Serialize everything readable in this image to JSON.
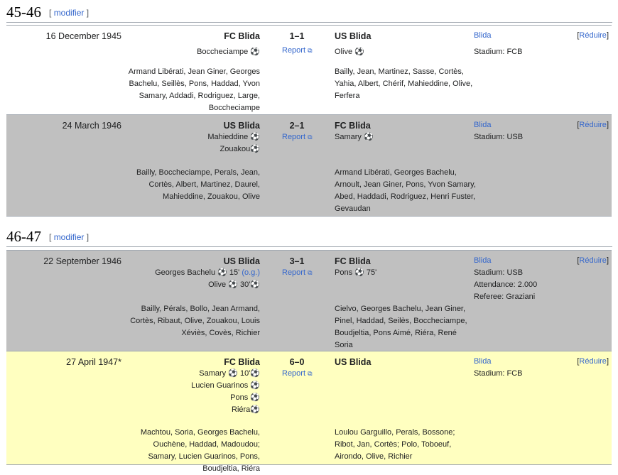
{
  "sections": [
    {
      "title": "45-46",
      "edit_open": "[",
      "edit_label": "modifier",
      "edit_close": "]"
    },
    {
      "title": "46-47",
      "edit_open": "[",
      "edit_label": "modifier",
      "edit_close": "]"
    }
  ],
  "matches": [
    {
      "date": "16 December 1945",
      "home": "FC Blida",
      "score": "1–1",
      "away": "US Blida",
      "venue": "Blida",
      "toggle_label": "Réduire",
      "report": "Report",
      "home_goals": [
        "Boccheciampe ⚽"
      ],
      "away_goals": [
        "Olive ⚽"
      ],
      "stadium_lines": [
        "Stadium: FCB"
      ],
      "home_lineup": "Armand Libérati, Jean Giner, Georges Bachelu, Seillès, Pons, Haddad, Yvon Samary, Addadi, Rodriguez, Large, Boccheciampe",
      "away_lineup": "Bailly, Jean, Martinez, Sasse, Cortès, Yahia, Albert, Chérif, Mahieddine, Olive, Ferfera"
    },
    {
      "date": "24 March 1946",
      "home": "US Blida",
      "score": "2–1",
      "away": "FC Blida",
      "venue": "Blida",
      "toggle_label": "Réduire",
      "report": "Report",
      "home_goals": [
        "Mahieddine ⚽",
        "Zouakou⚽"
      ],
      "away_goals": [
        "Samary ⚽"
      ],
      "stadium_lines": [
        "Stadium: USB"
      ],
      "home_lineup": "Bailly, Boccheciampe, Perals, Jean, Cortès, Albert, Martinez, Daurel, Mahieddine, Zouakou, Olive",
      "away_lineup": "Armand Libérati, Georges Bachelu, Arnoult, Jean Giner, Pons, Yvon Samary, Abed, Haddadi, Rodriguez, Henri Fuster, Gevaudan"
    },
    {
      "date": "22 September 1946",
      "home": "US Blida",
      "score": "3–1",
      "away": "FC Blida",
      "venue": "Blida",
      "toggle_label": "Réduire",
      "report": "Report",
      "home_goals": [
        "Georges Bachelu ⚽ 15'",
        "Olive ⚽ 30'⚽"
      ],
      "home_goal_og": "(o.g.)",
      "away_goals": [
        "Pons ⚽ 75'"
      ],
      "stadium_lines": [
        "Stadium: USB",
        "Attendance: 2.000",
        "Referee: Graziani"
      ],
      "home_lineup": "Bailly, Pérals, Bollo, Jean Armand, Cortès, Ribaut, Olive, Zouakou, Louis Xéviès, Covès, Richier",
      "away_lineup": "Cielvo, Georges Bachelu, Jean Giner, Pinel, Haddad, Seilès, Boccheciampe, Boudjeltia, Pons Aimé, Riéra, René Soria"
    },
    {
      "date": "27 April 1947*",
      "home": "FC Blida",
      "score": "6–0",
      "away": "US Blida",
      "venue": "Blida",
      "toggle_label": "Réduire",
      "report": "Report",
      "home_goals": [
        "Samary ⚽ 10'⚽",
        "Lucien Guarinos ⚽",
        "Pons ⚽",
        "Riéra⚽"
      ],
      "away_goals": [],
      "stadium_lines": [
        "Stadium: FCB"
      ],
      "home_lineup": "Machtou, Soria, Georges Bachelu, Ouchène, Haddad, Madoudou; Samary, Lucien Guarinos, Pons, Boudjeltia, Riéra",
      "away_lineup": "Loulou Garguillo, Perals, Bossone; Ribot, Jan, Cortès; Polo, Toboeuf, Airondo, Olive, Richier"
    }
  ]
}
